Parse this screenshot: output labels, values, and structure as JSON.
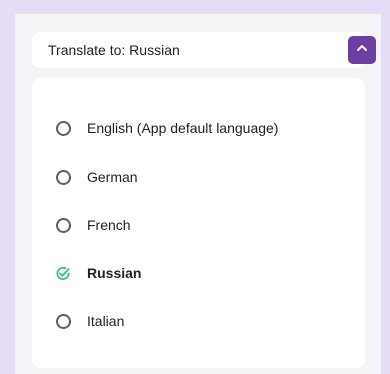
{
  "header": {
    "label": "Translate to: Russian",
    "toggle_icon": "chevron-up-icon"
  },
  "languages": [
    {
      "label": "English (App default language)",
      "selected": false
    },
    {
      "label": "German",
      "selected": false
    },
    {
      "label": "French",
      "selected": false
    },
    {
      "label": "Russian",
      "selected": true
    },
    {
      "label": "Italian",
      "selected": false
    }
  ],
  "colors": {
    "accent": "#6a3fa0",
    "selected_check": "#2bbf7a",
    "background": "#e6dcf5"
  }
}
